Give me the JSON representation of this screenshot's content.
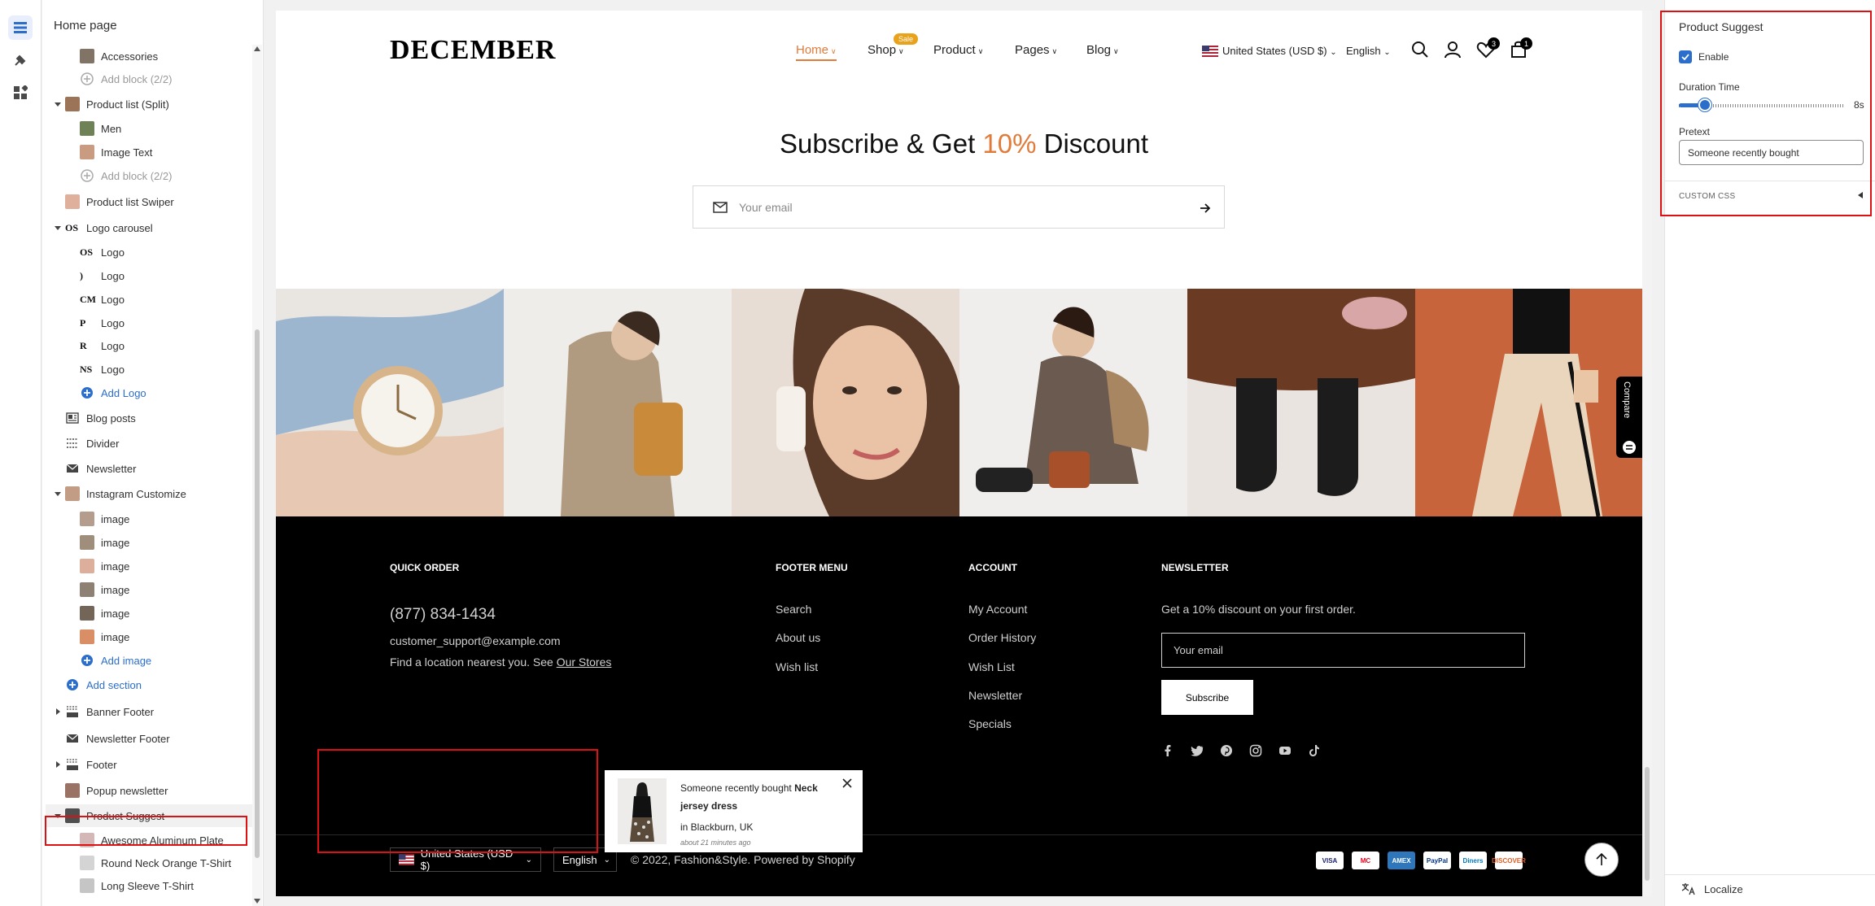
{
  "sidebar": {
    "title": "Home page",
    "items": [
      {
        "label": "Accessories",
        "level": 2,
        "icon": "thumb",
        "color": "#6b5a4a"
      },
      {
        "label": "Add block (2/2)",
        "level": 2,
        "icon": "plus",
        "muted": true
      },
      {
        "label": "Product list (Split)",
        "level": 1,
        "icon": "thumb",
        "caret": "down",
        "color": "#8a5a3a"
      },
      {
        "label": "Men",
        "level": 2,
        "icon": "thumb",
        "color": "#556b3a"
      },
      {
        "label": "Image Text",
        "level": 2,
        "icon": "thumb",
        "color": "#c08a6a"
      },
      {
        "label": "Add block (2/2)",
        "level": 2,
        "icon": "plus",
        "muted": true
      },
      {
        "label": "Product list Swiper",
        "level": 1,
        "icon": "thumb",
        "color": "#d9a28a"
      },
      {
        "label": "Logo carousel",
        "level": 1,
        "icon": "logo",
        "caret": "down",
        "glyph": "OS"
      },
      {
        "label": "Logo",
        "level": 2,
        "icon": "logo",
        "glyph": "OS"
      },
      {
        "label": "Logo",
        "level": 2,
        "icon": "logo",
        "glyph": ")"
      },
      {
        "label": "Logo",
        "level": 2,
        "icon": "logo",
        "glyph": "CM"
      },
      {
        "label": "Logo",
        "level": 2,
        "icon": "logo",
        "glyph": "P"
      },
      {
        "label": "Logo",
        "level": 2,
        "icon": "logo",
        "glyph": "R"
      },
      {
        "label": "Logo",
        "level": 2,
        "icon": "logo",
        "glyph": "NS"
      },
      {
        "label": "Add Logo",
        "level": 2,
        "icon": "plus-blue",
        "link": true
      },
      {
        "label": "Blog posts",
        "level": 1,
        "icon": "blog"
      },
      {
        "label": "Divider",
        "level": 1,
        "icon": "divider"
      },
      {
        "label": "Newsletter",
        "level": 1,
        "icon": "mail"
      },
      {
        "label": "Instagram Customize",
        "level": 1,
        "icon": "thumb",
        "caret": "down",
        "color": "#b98b70"
      },
      {
        "label": "image",
        "level": 2,
        "icon": "thumb",
        "color": "#a88c7a"
      },
      {
        "label": "image",
        "level": 2,
        "icon": "thumb",
        "color": "#8f7a66"
      },
      {
        "label": "image",
        "level": 2,
        "icon": "thumb",
        "color": "#d6a08a"
      },
      {
        "label": "image",
        "level": 2,
        "icon": "thumb",
        "color": "#7a6a5a"
      },
      {
        "label": "image",
        "level": 2,
        "icon": "thumb",
        "color": "#5a4a3a"
      },
      {
        "label": "image",
        "level": 2,
        "icon": "thumb",
        "color": "#d47a4a"
      },
      {
        "label": "Add image",
        "level": 2,
        "icon": "plus-blue",
        "link": true
      },
      {
        "label": "Add section",
        "level": 1,
        "icon": "plus-blue",
        "link": true
      },
      {
        "label": "Banner Footer",
        "level": 1,
        "icon": "footer",
        "caret": "right"
      },
      {
        "label": "Newsletter Footer",
        "level": 1,
        "icon": "mail"
      },
      {
        "label": "Footer",
        "level": 1,
        "icon": "footer",
        "caret": "right"
      },
      {
        "label": "Popup newsletter",
        "level": 1,
        "icon": "thumb",
        "color": "#8a5a4a"
      },
      {
        "label": "Product Suggest",
        "level": 1,
        "icon": "thumb",
        "caret": "down",
        "color": "#333",
        "selected": true
      },
      {
        "label": "Awesome Aluminum Plate",
        "level": 2,
        "icon": "thumb",
        "color": "#caa"
      },
      {
        "label": "Round Neck Orange T-Shirt",
        "level": 2,
        "icon": "thumb",
        "color": "#ccc"
      },
      {
        "label": "Long Sleeve T-Shirt",
        "level": 2,
        "icon": "thumb",
        "color": "#bbb"
      }
    ]
  },
  "header": {
    "logo": "DECEMBER",
    "nav": [
      {
        "label": "Home",
        "active": true
      },
      {
        "label": "Shop",
        "badge": "Sale"
      },
      {
        "label": "Product"
      },
      {
        "label": "Pages"
      },
      {
        "label": "Blog"
      }
    ],
    "currency": "United States (USD $)",
    "language": "English",
    "wishlist_count": "3",
    "cart_count": "1"
  },
  "subscribe": {
    "title_pre": "Subscribe & Get ",
    "title_accent": "10%",
    "title_post": " Discount",
    "placeholder": "Your email",
    "accent_color": "#e07b3a"
  },
  "compare_label": "Compare",
  "footer": {
    "quick_order": {
      "heading": "QUICK ORDER",
      "phone": "(877) 834-1434",
      "email": "customer_support@example.com",
      "location_text": "Find a location nearest you. See ",
      "stores_link": "Our Stores"
    },
    "footer_menu": {
      "heading": "FOOTER MENU",
      "items": [
        "Search",
        "About us",
        "Wish list"
      ]
    },
    "account": {
      "heading": "ACCOUNT",
      "items": [
        "My Account",
        "Order History",
        "Wish List",
        "Newsletter",
        "Specials"
      ]
    },
    "newsletter": {
      "heading": "NEWSLETTER",
      "text": "Get a 10% discount on your first order.",
      "placeholder": "Your email",
      "button": "Subscribe"
    },
    "social": [
      "facebook-icon",
      "twitter-icon",
      "pinterest-icon",
      "instagram-icon",
      "youtube-icon",
      "tiktok-icon"
    ],
    "currency": "United States (USD $)",
    "language": "English",
    "copyright": "© 2022, Fashion&Style. Powered by Shopify",
    "payments": [
      "VISA",
      "MC",
      "AMEX",
      "PayPal",
      "Diners",
      "DISCOVER"
    ]
  },
  "popup": {
    "pretext": "Someone recently bought ",
    "product": "Neck jersey dress",
    "location": "in Blackburn, UK",
    "time": "about 21 minutes ago"
  },
  "settings": {
    "title": "Product Suggest",
    "enable_label": "Enable",
    "enabled": true,
    "duration_label": "Duration Time",
    "duration_value": "8s",
    "duration_fraction": 0.16,
    "pretext_label": "Pretext",
    "pretext_value": "Someone recently bought",
    "custom_css_label": "CUSTOM CSS",
    "localize_label": "Localize",
    "accent": "#2c6ecb"
  }
}
